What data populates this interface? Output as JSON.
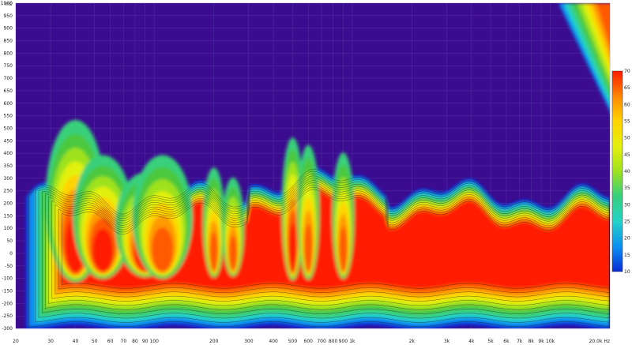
{
  "chart_data": {
    "type": "heatmap",
    "title": "",
    "xlabel": "",
    "ylabel": "",
    "x_scale": "log",
    "xlim": [
      20,
      20000
    ],
    "ylim": [
      -300,
      1000
    ],
    "x_ticks": [
      {
        "v": 20,
        "label": "20"
      },
      {
        "v": 30,
        "label": "30"
      },
      {
        "v": 40,
        "label": "40"
      },
      {
        "v": 50,
        "label": "50"
      },
      {
        "v": 60,
        "label": "60"
      },
      {
        "v": 70,
        "label": "70"
      },
      {
        "v": 80,
        "label": "80"
      },
      {
        "v": 90,
        "label": "90"
      },
      {
        "v": 100,
        "label": "100"
      },
      {
        "v": 200,
        "label": "200"
      },
      {
        "v": 300,
        "label": "300"
      },
      {
        "v": 400,
        "label": "400"
      },
      {
        "v": 500,
        "label": "500"
      },
      {
        "v": 600,
        "label": "600"
      },
      {
        "v": 700,
        "label": "700"
      },
      {
        "v": 800,
        "label": "800"
      },
      {
        "v": 900,
        "label": "900"
      },
      {
        "v": 1000,
        "label": "1k"
      },
      {
        "v": 2000,
        "label": "2k"
      },
      {
        "v": 3000,
        "label": "3k"
      },
      {
        "v": 4000,
        "label": "4k"
      },
      {
        "v": 5000,
        "label": "5k"
      },
      {
        "v": 6000,
        "label": "6k"
      },
      {
        "v": 7000,
        "label": "7k"
      },
      {
        "v": 8000,
        "label": "8k"
      },
      {
        "v": 9000,
        "label": "9k"
      },
      {
        "v": 10000,
        "label": "10k"
      },
      {
        "v": 20000,
        "label": "20.0k Hz"
      }
    ],
    "y_ticks": [
      1000,
      950,
      900,
      850,
      800,
      750,
      700,
      650,
      600,
      550,
      500,
      450,
      400,
      350,
      300,
      250,
      200,
      150,
      100,
      50,
      0,
      -50,
      -100,
      -150,
      -200,
      -250,
      -300
    ],
    "y_top_label": "ms",
    "colorbar": {
      "range": [
        10,
        70
      ],
      "ticks": [
        70,
        65,
        60,
        55,
        50,
        45,
        40,
        35,
        30,
        25,
        20,
        15,
        10
      ],
      "colors": [
        "#3b0c8f",
        "#0a2bd6",
        "#0a8cf0",
        "#23d2c8",
        "#38d07a",
        "#4cc83c",
        "#9ee21e",
        "#e2f00e",
        "#ffd400",
        "#ff9a00",
        "#ff5a00",
        "#ff1a00"
      ]
    },
    "resonance_peaks": [
      {
        "x": 40,
        "y_top": 470,
        "level": 70
      },
      {
        "x": 55,
        "y_top": 330,
        "level": 70
      },
      {
        "x": 90,
        "y_top": 260,
        "level": 70
      },
      {
        "x": 110,
        "y_top": 330,
        "level": 65
      },
      {
        "x": 200,
        "y_top": 280,
        "level": 67
      },
      {
        "x": 250,
        "y_top": 240,
        "level": 66
      },
      {
        "x": 500,
        "y_top": 400,
        "level": 68
      },
      {
        "x": 600,
        "y_top": 370,
        "level": 66
      },
      {
        "x": 900,
        "y_top": 340,
        "level": 65
      }
    ],
    "high_freq_band": {
      "x_start": 11000,
      "x_end": 20000,
      "level": 62
    }
  }
}
